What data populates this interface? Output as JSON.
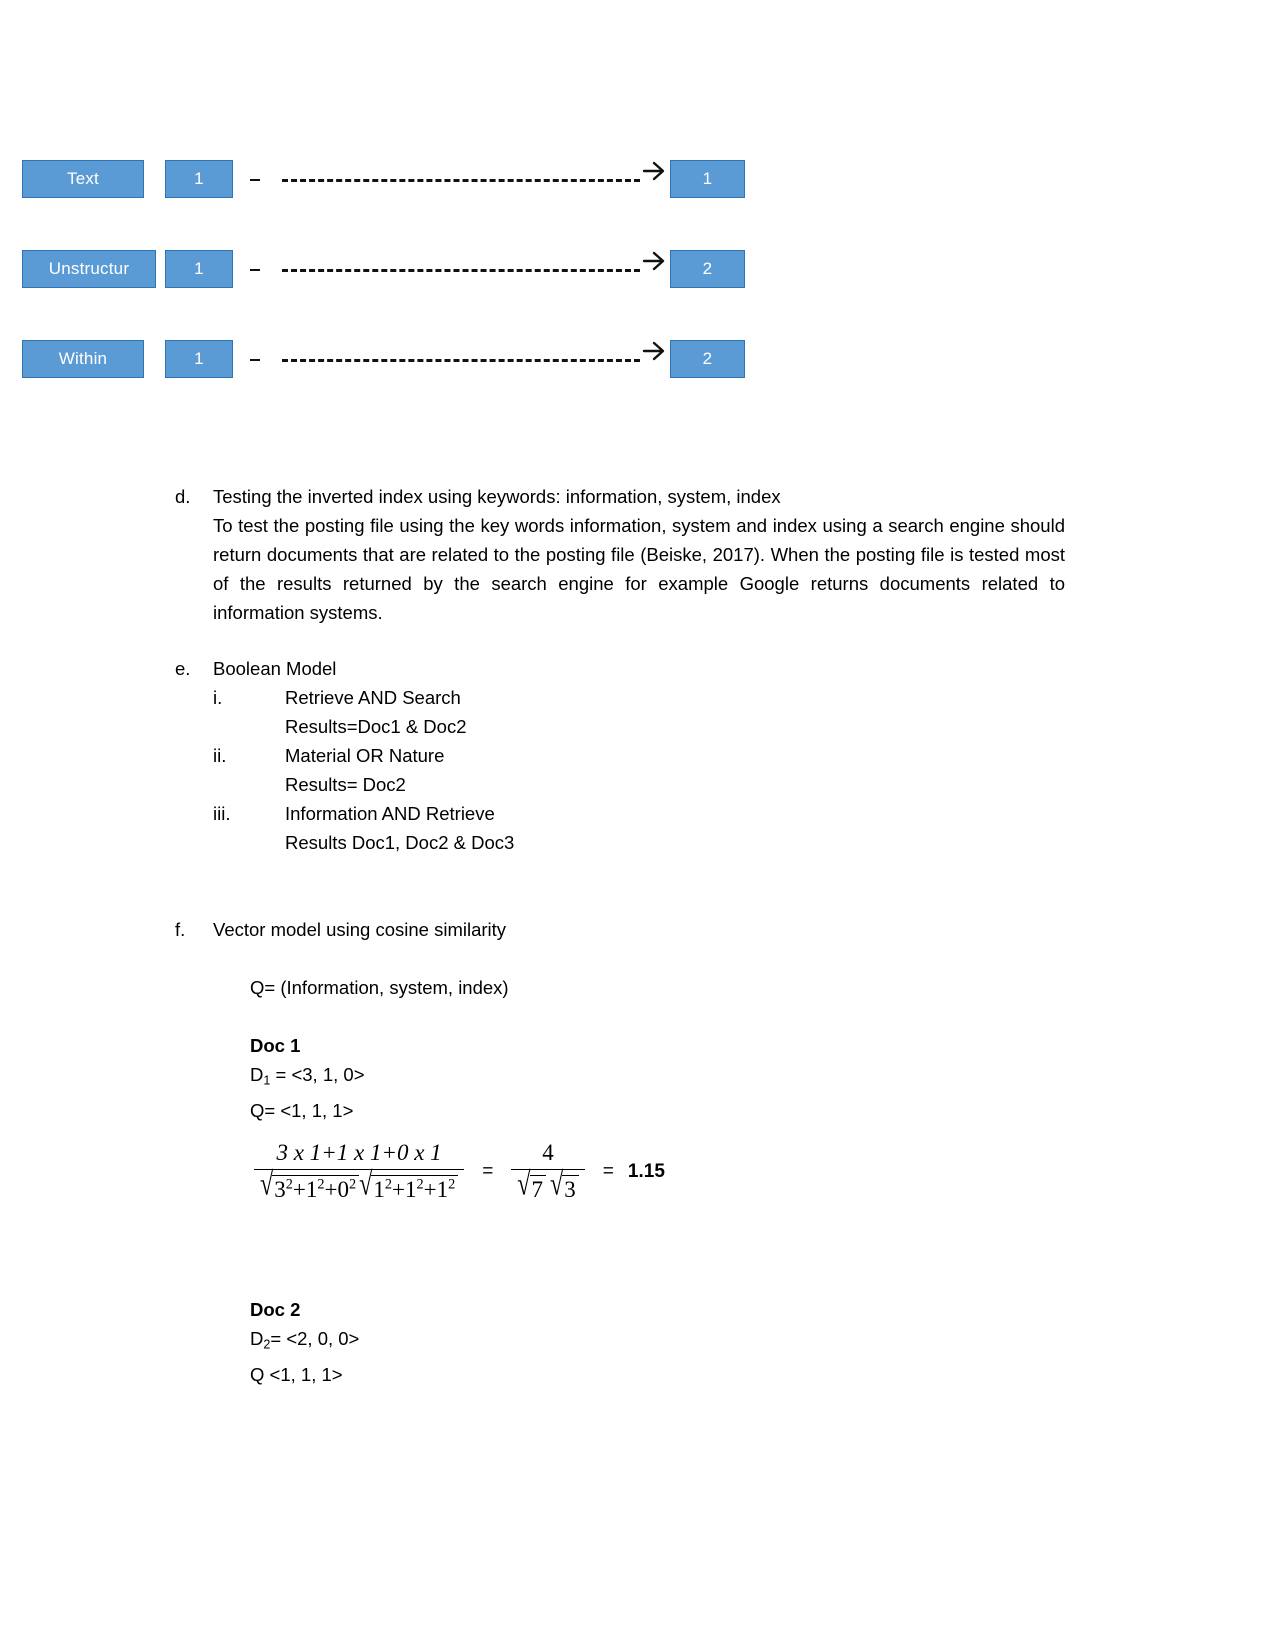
{
  "diagram": {
    "rows": [
      {
        "term": "Text",
        "count": "1",
        "posting": "1"
      },
      {
        "term": "Unstructur",
        "count": "1",
        "posting": "2"
      },
      {
        "term": "Within",
        "count": "1",
        "posting": "2"
      }
    ],
    "colors": {
      "fill": "#5B9BD5",
      "border": "#2E75B6",
      "text": "#FFFFFF",
      "connector": "#111111"
    }
  },
  "item_d": {
    "marker": "d.",
    "heading": "Testing the inverted index using keywords: information, system, index",
    "paragraph": "To test the posting file using the key words information, system and index using a search engine should return documents that are related to the posting file (Beiske, 2017). When the posting file is tested most of the results returned by the search engine for example Google returns documents related to information systems."
  },
  "item_e": {
    "marker": "e.",
    "heading": "Boolean Model",
    "sub_items": [
      {
        "marker": "i.",
        "query": "Retrieve AND Search",
        "result": "Results=Doc1 & Doc2"
      },
      {
        "marker": "ii.",
        "query": "Material OR Nature",
        "result": "Results= Doc2"
      },
      {
        "marker": "iii.",
        "query": "Information AND Retrieve",
        "result": "Results Doc1, Doc2 & Doc3"
      }
    ]
  },
  "item_f": {
    "marker": "f.",
    "heading": "Vector model using cosine similarity",
    "query_line": "Q= (Information, system, index)",
    "doc1": {
      "title": "Doc 1",
      "vector_label": "D",
      "vector_sub": "1",
      "vector_value": " = <3, 1, 0>",
      "query_vector": "Q= <1, 1, 1>"
    },
    "formula": {
      "numerator": "3 x 1+1 x 1+0 x 1",
      "den_sqrt1": {
        "base1": "3",
        "exp1": "2",
        "base2": "1",
        "exp2": "2",
        "base3": "0",
        "exp3": "2"
      },
      "den_sqrt2": {
        "base1": "1",
        "exp1": "2",
        "base2": "1",
        "exp2": "2",
        "base3": "1",
        "exp3": "2"
      },
      "equals_1": "=",
      "simplified_num": "4",
      "simplified_den_a": "7",
      "simplified_den_b": "3",
      "equals_2": "=",
      "result": "1.15"
    },
    "doc2": {
      "title": "Doc 2",
      "vector_label": "D",
      "vector_sub": "2",
      "vector_value": "= <2, 0, 0>",
      "query_vector": "Q <1, 1, 1>"
    }
  }
}
